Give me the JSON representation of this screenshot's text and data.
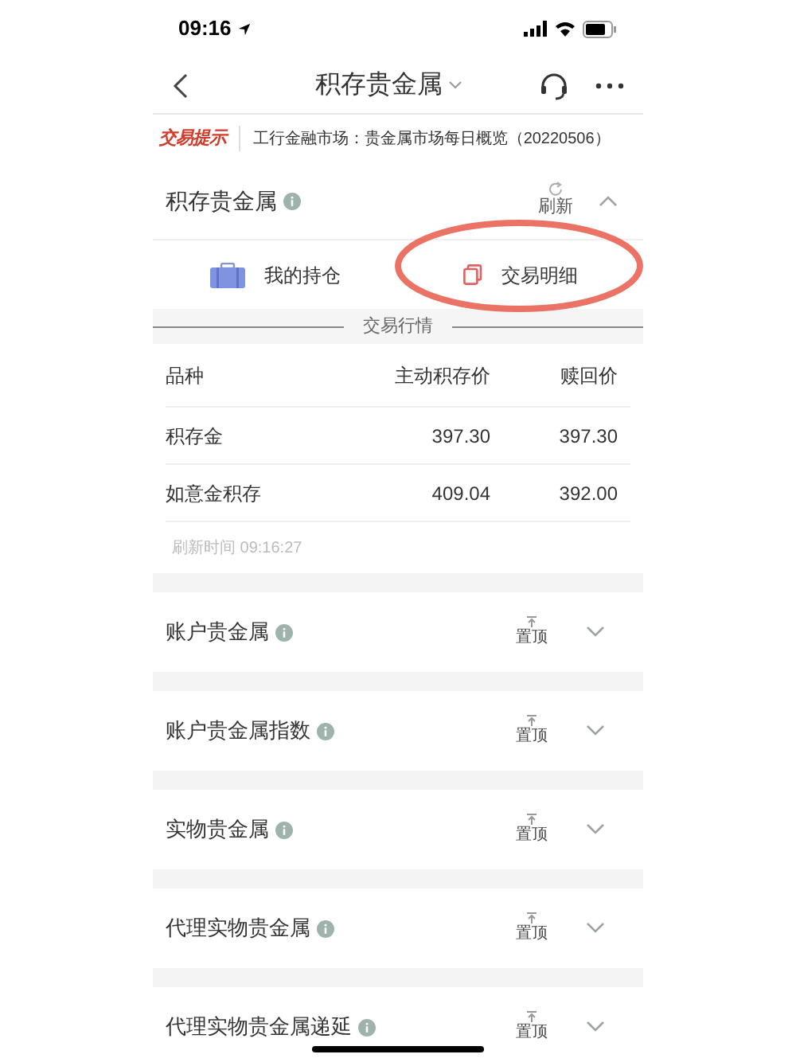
{
  "status_bar": {
    "time": "09:16"
  },
  "nav": {
    "title": "积存贵金属"
  },
  "notice": {
    "tag": "交易提示",
    "text": "工行金融市场：贵金属市场每日概览（20220506）"
  },
  "main_section": {
    "title": "积存贵金属",
    "refresh": "刷新",
    "expanded": true,
    "tabs": [
      {
        "label": "我的持仓",
        "kind": "holdings",
        "selected": false
      },
      {
        "label": "交易明细",
        "kind": "detail",
        "selected": false
      }
    ],
    "divider_label": "交易行情",
    "table": {
      "columns": [
        "品种",
        "主动积存价",
        "赎回价"
      ],
      "rows": [
        [
          "积存金",
          "397.30",
          "397.30"
        ],
        [
          "如意金积存",
          "409.04",
          "392.00"
        ]
      ]
    },
    "refresh_time": "刷新时间 09:16:27"
  },
  "sections": [
    {
      "title": "账户贵金属",
      "pin": "置顶",
      "expanded": false
    },
    {
      "title": "账户贵金属指数",
      "pin": "置顶",
      "expanded": false
    },
    {
      "title": "实物贵金属",
      "pin": "置顶",
      "expanded": false
    },
    {
      "title": "代理实物贵金属",
      "pin": "置顶",
      "expanded": false
    },
    {
      "title": "代理实物贵金属递延",
      "pin": "置顶",
      "expanded": false
    }
  ],
  "annotation": {
    "kind": "circle"
  }
}
